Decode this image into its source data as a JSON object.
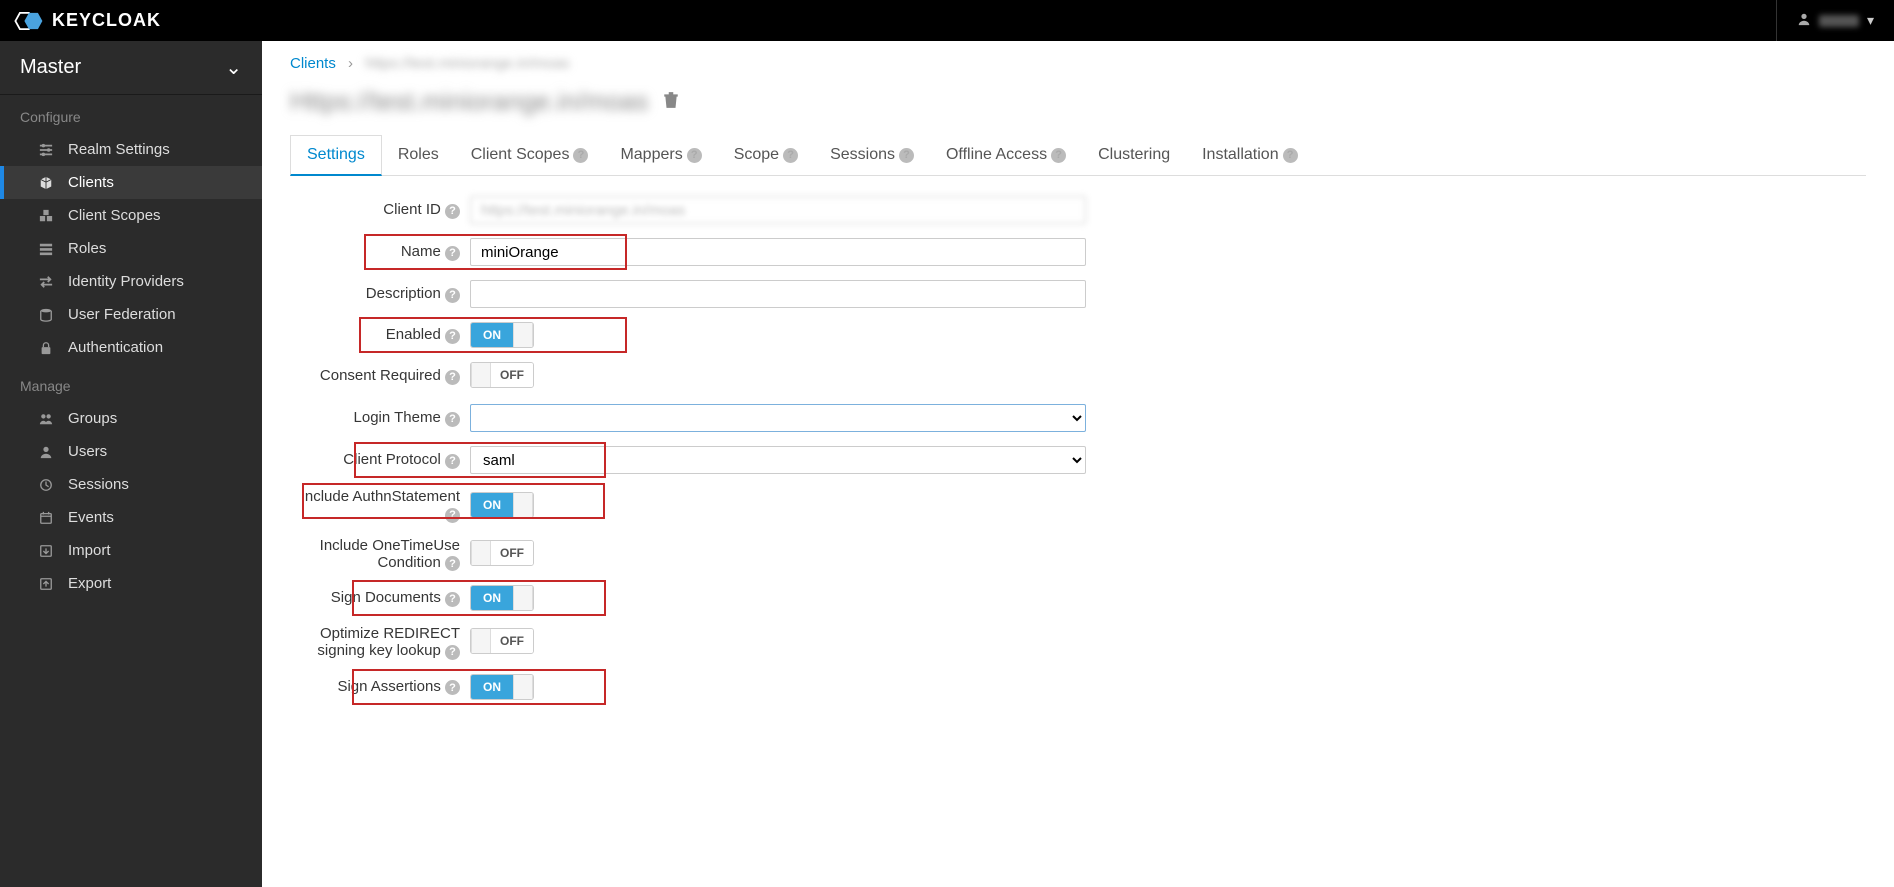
{
  "topbar": {
    "brand": "KEYCLOAK"
  },
  "sidebar": {
    "realm": "Master",
    "configure_header": "Configure",
    "configure": [
      {
        "label": "Realm Settings",
        "active": false
      },
      {
        "label": "Clients",
        "active": true
      },
      {
        "label": "Client Scopes",
        "active": false
      },
      {
        "label": "Roles",
        "active": false
      },
      {
        "label": "Identity Providers",
        "active": false
      },
      {
        "label": "User Federation",
        "active": false
      },
      {
        "label": "Authentication",
        "active": false
      }
    ],
    "manage_header": "Manage",
    "manage": [
      {
        "label": "Groups"
      },
      {
        "label": "Users"
      },
      {
        "label": "Sessions"
      },
      {
        "label": "Events"
      },
      {
        "label": "Import"
      },
      {
        "label": "Export"
      }
    ]
  },
  "breadcrumb": {
    "root": "Clients",
    "current_blurred": "https://test.miniorange.in/moas"
  },
  "page_title_blurred": "Https://test.miniorange.in/moas",
  "tabs": [
    {
      "label": "Settings",
      "active": true,
      "help": false
    },
    {
      "label": "Roles",
      "active": false,
      "help": false
    },
    {
      "label": "Client Scopes",
      "active": false,
      "help": true
    },
    {
      "label": "Mappers",
      "active": false,
      "help": true
    },
    {
      "label": "Scope",
      "active": false,
      "help": true
    },
    {
      "label": "Sessions",
      "active": false,
      "help": true
    },
    {
      "label": "Offline Access",
      "active": false,
      "help": true
    },
    {
      "label": "Clustering",
      "active": false,
      "help": false
    },
    {
      "label": "Installation",
      "active": false,
      "help": true
    }
  ],
  "form": {
    "client_id": {
      "label": "Client ID",
      "value_blurred": "https://test.miniorange.in/moas"
    },
    "name": {
      "label": "Name",
      "value": "miniOrange",
      "highlight": true
    },
    "description": {
      "label": "Description",
      "value": ""
    },
    "enabled": {
      "label": "Enabled",
      "on": true,
      "highlight": true
    },
    "consent_required": {
      "label": "Consent Required",
      "on": false
    },
    "login_theme": {
      "label": "Login Theme",
      "value": ""
    },
    "client_protocol": {
      "label": "Client Protocol",
      "value": "saml",
      "highlight": true
    },
    "include_authn": {
      "label": "Include AuthnStatement",
      "on": true,
      "highlight": true
    },
    "include_onetime": {
      "label": "Include OneTimeUse Condition",
      "on": false
    },
    "sign_documents": {
      "label": "Sign Documents",
      "on": true,
      "highlight": true
    },
    "optimize_redirect": {
      "label": "Optimize REDIRECT signing key lookup",
      "on": false
    },
    "sign_assertions": {
      "label": "Sign Assertions",
      "on": true,
      "highlight": true
    }
  },
  "toggle_labels": {
    "on": "ON",
    "off": "OFF"
  }
}
